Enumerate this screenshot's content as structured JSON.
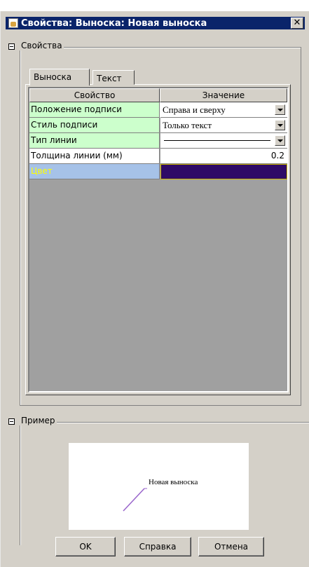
{
  "window": {
    "title": "Свойства: Выноска: Новая выноска"
  },
  "groups": {
    "properties": "Свойства",
    "example": "Пример"
  },
  "tabs": [
    {
      "label": "Выноска",
      "active": true
    },
    {
      "label": "Текст",
      "active": false
    }
  ],
  "grid": {
    "headers": [
      "Свойство",
      "Значение"
    ],
    "rows": [
      {
        "name": "Положение подписи",
        "value": "Справа и сверху",
        "type": "combo"
      },
      {
        "name": "Стиль подписи",
        "value": "Только текст",
        "type": "combo"
      },
      {
        "name": "Тип линии",
        "value": "",
        "type": "line-combo"
      },
      {
        "name": "Толщина линии (мм)",
        "value": "0.2",
        "type": "number"
      },
      {
        "name": "Цвет",
        "value": "",
        "type": "color"
      }
    ]
  },
  "colors": {
    "editable_cell": "#ccffcc",
    "selected_cell": "#a6c2e8",
    "selected_text": "#ffff00",
    "line_color_value": "#2e0a66",
    "callout_line": "#9a66cc"
  },
  "preview": {
    "label": "Новая выноска"
  },
  "buttons": {
    "ok": "OK",
    "help": "Справка",
    "cancel": "Отмена"
  },
  "icons": {
    "app": "app-icon",
    "close": "close-icon",
    "collapse": "minus-box-icon",
    "dropdown": "dropdown-arrow-icon"
  }
}
